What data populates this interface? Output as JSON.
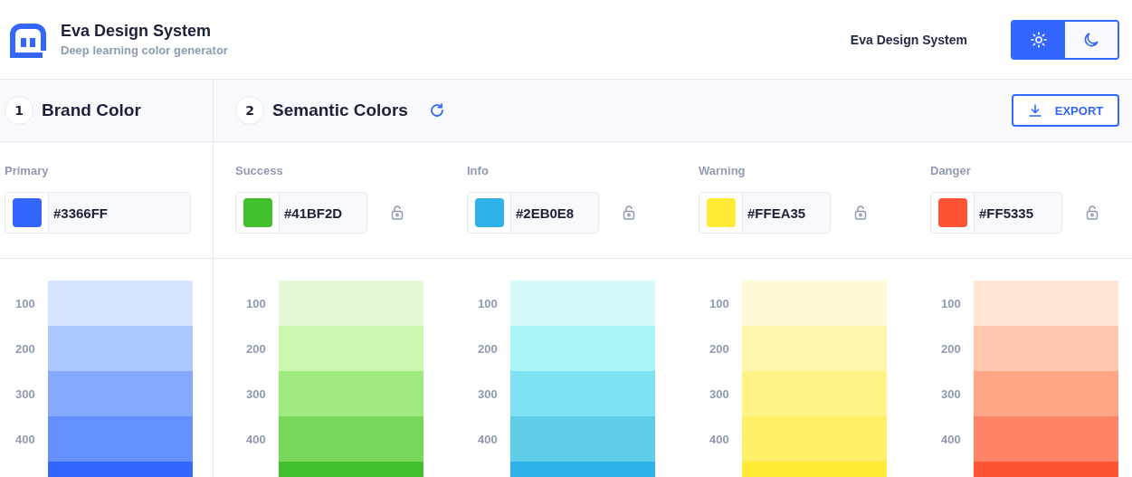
{
  "brand": {
    "title": "Eva Design System",
    "subtitle": "Deep learning color generator"
  },
  "nav_link": "Eva Design System",
  "theme_toggle": [
    {
      "kind": "light",
      "selected": true
    },
    {
      "kind": "dark",
      "selected": false
    }
  ],
  "steps": [
    {
      "number": "1",
      "title": "Brand Color"
    },
    {
      "number": "2",
      "title": "Semantic Colors"
    }
  ],
  "export_button": "EXPORT",
  "palettes": [
    {
      "name": "Primary",
      "hex": "#3366FF",
      "color": "#3366ff",
      "lockable": false,
      "shades": [
        {
          "label": "100",
          "color": "#d6e4ff"
        },
        {
          "label": "200",
          "color": "#adc8ff"
        },
        {
          "label": "300",
          "color": "#84a9ff"
        },
        {
          "label": "400",
          "color": "#6690ff"
        },
        {
          "color": "#3366ff"
        }
      ]
    },
    {
      "name": "Success",
      "hex": "#41BF2D",
      "color": "#41bf2d",
      "lockable": true,
      "shades": [
        {
          "label": "100",
          "color": "#e6f9d6"
        },
        {
          "label": "200",
          "color": "#cbf8ae"
        },
        {
          "label": "300",
          "color": "#a0eb7f"
        },
        {
          "label": "400",
          "color": "#77d85b"
        },
        {
          "color": "#41bf2d"
        }
      ]
    },
    {
      "name": "Info",
      "hex": "#2EB0E8",
      "color": "#2eb0e8",
      "lockable": true,
      "shades": [
        {
          "label": "100",
          "color": "#d4fbf9"
        },
        {
          "label": "200",
          "color": "#abf4f8"
        },
        {
          "label": "300",
          "color": "#7fe2f3"
        },
        {
          "label": "400",
          "color": "#5ecde8"
        },
        {
          "color": "#2eb0e8"
        }
      ]
    },
    {
      "name": "Warning",
      "hex": "#FFEA35",
      "color": "#ffea35",
      "lockable": true,
      "shades": [
        {
          "label": "100",
          "color": "#fffbd6"
        },
        {
          "label": "200",
          "color": "#fff7ae"
        },
        {
          "label": "300",
          "color": "#fff286"
        },
        {
          "label": "400",
          "color": "#ffee68"
        },
        {
          "color": "#ffea35"
        }
      ]
    },
    {
      "name": "Danger",
      "hex": "#FF5335",
      "color": "#ff5335",
      "lockable": true,
      "shades": [
        {
          "label": "100",
          "color": "#ffe6d6"
        },
        {
          "label": "200",
          "color": "#ffc8ae"
        },
        {
          "label": "300",
          "color": "#ffa686"
        },
        {
          "label": "400",
          "color": "#ff8467"
        },
        {
          "color": "#ff5335"
        }
      ]
    }
  ]
}
